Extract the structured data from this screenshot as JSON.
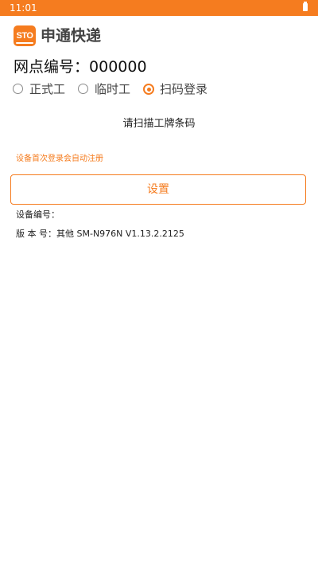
{
  "status_bar": {
    "time": "11:01",
    "battery_icon": "battery-icon"
  },
  "header": {
    "logo_text": "STO",
    "brand_name": "申通快递"
  },
  "station": {
    "label": "网点编号：",
    "value": "000000"
  },
  "login_mode": {
    "options": [
      {
        "label": "正式工",
        "checked": false
      },
      {
        "label": "临时工",
        "checked": false
      },
      {
        "label": "扫码登录",
        "checked": true
      }
    ]
  },
  "scan_prompt": "请扫描工牌条码",
  "auto_register_note": "设备首次登录会自动注册",
  "settings_button_label": "设置",
  "device_info": {
    "device_label": "设备编号：",
    "device_value": "",
    "version_label": "版 本 号：",
    "version_value": "其他 SM-N976N V1.13.2.2125"
  },
  "colors": {
    "accent": "#f57c1f",
    "text": "#222222",
    "radio_unchecked": "#8a8a8a"
  }
}
